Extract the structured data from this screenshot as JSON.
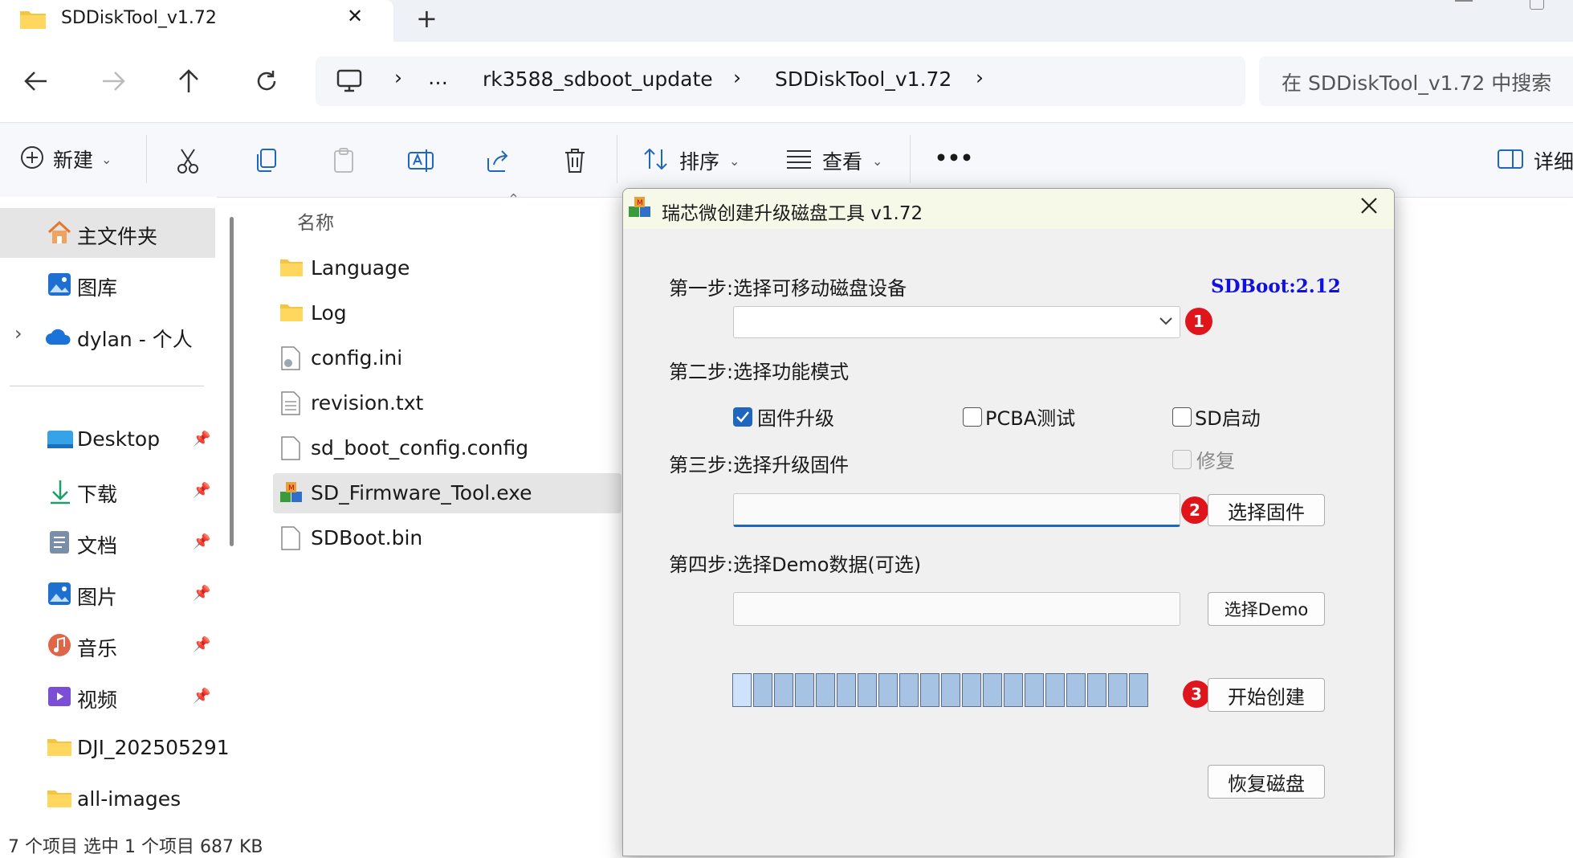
{
  "tab": {
    "title": "SDDiskTool_v1.72",
    "close": "✕",
    "new_tab": "+"
  },
  "nav": {
    "crumbs": [
      "…",
      "rk3588_sdboot_update",
      "SDDiskTool_v1.72"
    ],
    "search_placeholder": "在 SDDiskTool_v1.72 中搜索"
  },
  "toolbar": {
    "new_label": "新建",
    "sort_label": "排序",
    "view_label": "查看",
    "more_label": "•••",
    "details_label": "详细"
  },
  "sidebar": {
    "items": [
      "主文件夹",
      "图库",
      "dylan - 个人",
      "Desktop",
      "下载",
      "文档",
      "图片",
      "音乐",
      "视频",
      "DJI_202505291",
      "all-images"
    ]
  },
  "filelist": {
    "column_name": "名称",
    "files": [
      "Language",
      "Log",
      "config.ini",
      "revision.txt",
      "sd_boot_config.config",
      "SD_Firmware_Tool.exe",
      "SDBoot.bin"
    ]
  },
  "statusbar": {
    "text": "7 个项目    选中 1 个项目  687 KB"
  },
  "dialog": {
    "title": "瑞芯微创建升级磁盘工具 v1.72",
    "version": "SDBoot:2.12",
    "step1": "第一步:选择可移动磁盘设备",
    "step2": "第二步:选择功能模式",
    "step3": "第三步:选择升级固件",
    "step4": "第四步:选择Demo数据(可选)",
    "opt_firmware": "固件升级",
    "opt_pcba": "PCBA测试",
    "opt_sdboot": "SD启动",
    "opt_repair": "修复",
    "btn_firmware": "选择固件",
    "btn_demo": "选择Demo",
    "btn_start": "开始创建",
    "btn_restore": "恢复磁盘",
    "badges": [
      "1",
      "2",
      "3"
    ],
    "progress": 0.0
  }
}
